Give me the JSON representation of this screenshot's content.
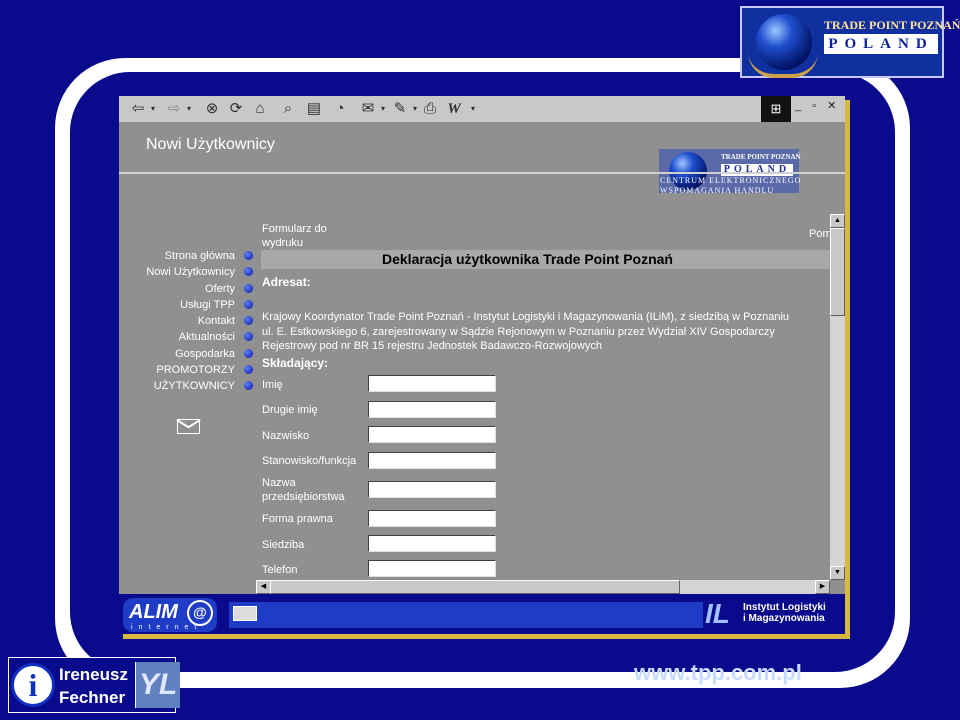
{
  "slide": {
    "top_logo": {
      "line1": "TRADE POINT POZNAŃ",
      "line2": "POLAND"
    },
    "author": {
      "first_name": "Ireneusz",
      "last_name": "Fechner",
      "logo_letters": "YL"
    },
    "url": "www.tpp.com.pl"
  },
  "browser": {
    "toolbar_icons": [
      "back-icon",
      "forward-icon",
      "stop-icon",
      "refresh-icon",
      "home-icon",
      "search-icon",
      "favorites-icon",
      "history-icon",
      "mail-icon",
      "print-icon",
      "edit-icon"
    ],
    "header": {
      "title": "Nowi Użytkownicy",
      "logo_line1": "TRADE POINT POZNAŃ",
      "logo_line2": "POLAND",
      "subtitle_line1": "CENTRUM ELEKTRONICZNEGO",
      "subtitle_line2": "WSPOMAGANIA HANDLU"
    },
    "sidebar": {
      "items": [
        {
          "label": "Strona główna"
        },
        {
          "label": "Nowi Użytkownicy"
        },
        {
          "label": "Oferty"
        },
        {
          "label": "Usługi TPP"
        },
        {
          "label": "Kontakt"
        },
        {
          "label": "Aktualności"
        },
        {
          "label": "Gospodarka"
        },
        {
          "label": "PROMOTORZY"
        },
        {
          "label": "UŻYTKOWNICY"
        }
      ]
    },
    "content": {
      "print_link_line1": "Formularz do",
      "print_link_line2": "wydruku",
      "help_link": "Pom",
      "declaration_title": "Deklaracja użytkownika Trade Point Poznań",
      "addressee_label": "Adresat:",
      "address_lines": [
        "Krajowy Koordynator Trade Point Poznań - Instytut Logistyki i Magazynowania (ILiM), z siedzibą w Poznaniu",
        "ul. E. Estkowskiego 6, zarejestrowany w Sądzie Rejonowym w Poznaniu przez Wydział XIV Gospodarczy",
        "Rejestrowy pod nr BR 15 rejestru Jednostek Badawczo-Rozwojowych"
      ],
      "submitter_label": "Składający:",
      "fields": [
        {
          "label": "Imię",
          "value": ""
        },
        {
          "label": "Drugie imię",
          "value": ""
        },
        {
          "label": "Nazwisko",
          "value": ""
        },
        {
          "label": "Stanowisko/funkcja",
          "value": ""
        },
        {
          "label_line1": "Nazwa",
          "label_line2": "przedsiębiorstwa",
          "value": ""
        },
        {
          "label": "Forma prawna",
          "value": ""
        },
        {
          "label": "Siedziba",
          "value": ""
        },
        {
          "label": "Telefon",
          "value": ""
        }
      ]
    },
    "footer": {
      "alim_text": "ALIM",
      "alim_sub": "internet",
      "ilim_line1": "Instytut Logistyki",
      "ilim_line2": "i Magazynowania"
    }
  }
}
